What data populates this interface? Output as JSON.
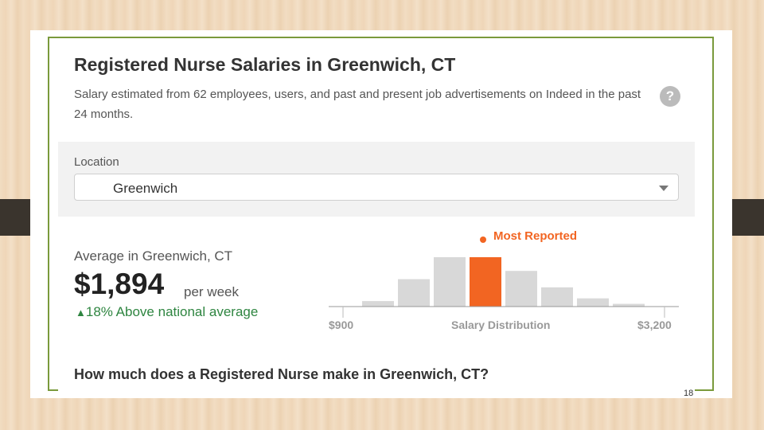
{
  "header": {
    "title": "Registered Nurse Salaries in Greenwich, CT",
    "subtitle": "Salary estimated from 62 employees, users, and past and present job advertisements on Indeed in the past 24 months.",
    "help_glyph": "?"
  },
  "location": {
    "label": "Location",
    "selected": "Greenwich"
  },
  "average": {
    "label": "Average in Greenwich, CT",
    "value": "$1,894",
    "period": "per week",
    "compare_arrow": "▲",
    "compare_text": "18% Above national average"
  },
  "chart_data": {
    "type": "bar",
    "title": "",
    "xlabel": "Salary Distribution",
    "ylabel": "",
    "x_min_label": "$900",
    "x_max_label": "$3,200",
    "highlight_label": "Most Reported",
    "highlight_index": 3,
    "values": [
      1,
      5,
      9,
      9,
      6.5,
      3.5,
      1.5,
      0.5
    ],
    "colors": {
      "bar": "#d8d8d8",
      "highlight": "#f26522"
    }
  },
  "faq": {
    "question": "How much does a Registered Nurse make in Greenwich, CT?"
  },
  "slide": {
    "page_number": "18"
  }
}
